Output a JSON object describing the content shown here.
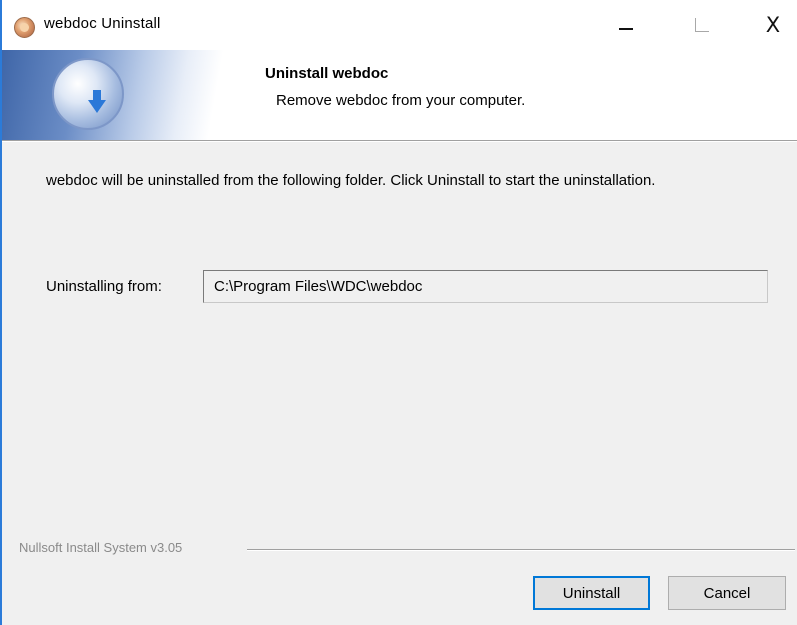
{
  "window": {
    "title": "webdoc Uninstall",
    "controls": {
      "minimize": "–",
      "maximize": "□",
      "close": "X"
    }
  },
  "header": {
    "title": "Uninstall webdoc",
    "subtitle": "Remove webdoc from your computer."
  },
  "main": {
    "intro_text": "webdoc will be uninstalled from the following folder. Click Uninstall to start the uninstallation.",
    "from_label": "Uninstalling from:",
    "path_value": "C:\\Program Files\\WDC\\webdoc"
  },
  "footer": {
    "branding": "Nullsoft Install System v3.05",
    "uninstall_label": "Uninstall",
    "cancel_label": "Cancel"
  },
  "colors": {
    "accent": "#0078d7",
    "window_bg": "#f0f0f0",
    "frame": "#2b7bd9"
  }
}
